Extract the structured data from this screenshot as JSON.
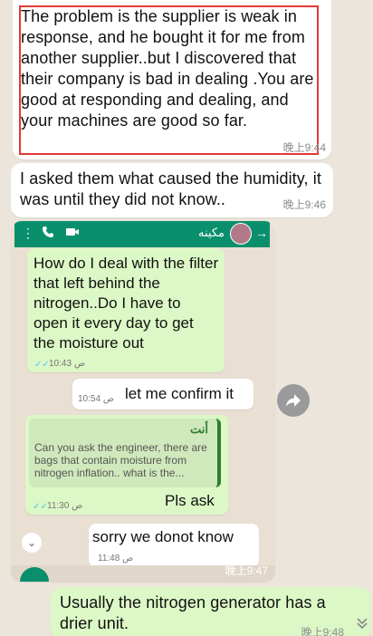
{
  "messages": [
    {
      "id": "m1",
      "text": "The problem is the supplier is weak in response, and he bought it for me from another supplier..but I discovered that their company is bad in dealing .You are good at responding and dealing, and your machines are good so far.",
      "time": "晚上9:44"
    },
    {
      "id": "m2",
      "text": "I asked them what caused the humidity, it was until they did not know..",
      "time": "晚上9:46"
    },
    {
      "id": "m3",
      "time": "晚上9:47",
      "screenshot": {
        "contact_name": "مكينه",
        "messages": [
          {
            "text": "How do I deal with the filter that left behind the nitrogen..Do I have to open it every day to get the moisture out",
            "time": "10:43 ص"
          },
          {
            "text": "let me confirm it",
            "time": "10:54 ص"
          },
          {
            "quote_author": "أنت",
            "quote_text": "Can you ask the engineer, there are bags that contain moisture from nitrogen inflation.. what is the...",
            "text": "Pls ask",
            "time": "11:30 ص"
          },
          {
            "text": "sorry we donot know",
            "time": "11:48 ص"
          }
        ]
      }
    },
    {
      "id": "m4",
      "text": "Usually the nitrogen generator has a drier unit.",
      "time": "晚上9:48"
    }
  ],
  "icons": {
    "forward": "forward-icon",
    "scroll_down": "chevron-double-down-icon"
  },
  "colors": {
    "chat_background": "#ece5dc",
    "incoming_bubble": "#ffffff",
    "outgoing_bubble": "#dcf8c6",
    "highlight_border": "#e53935",
    "whatsapp_green": "#0a8f6c"
  }
}
